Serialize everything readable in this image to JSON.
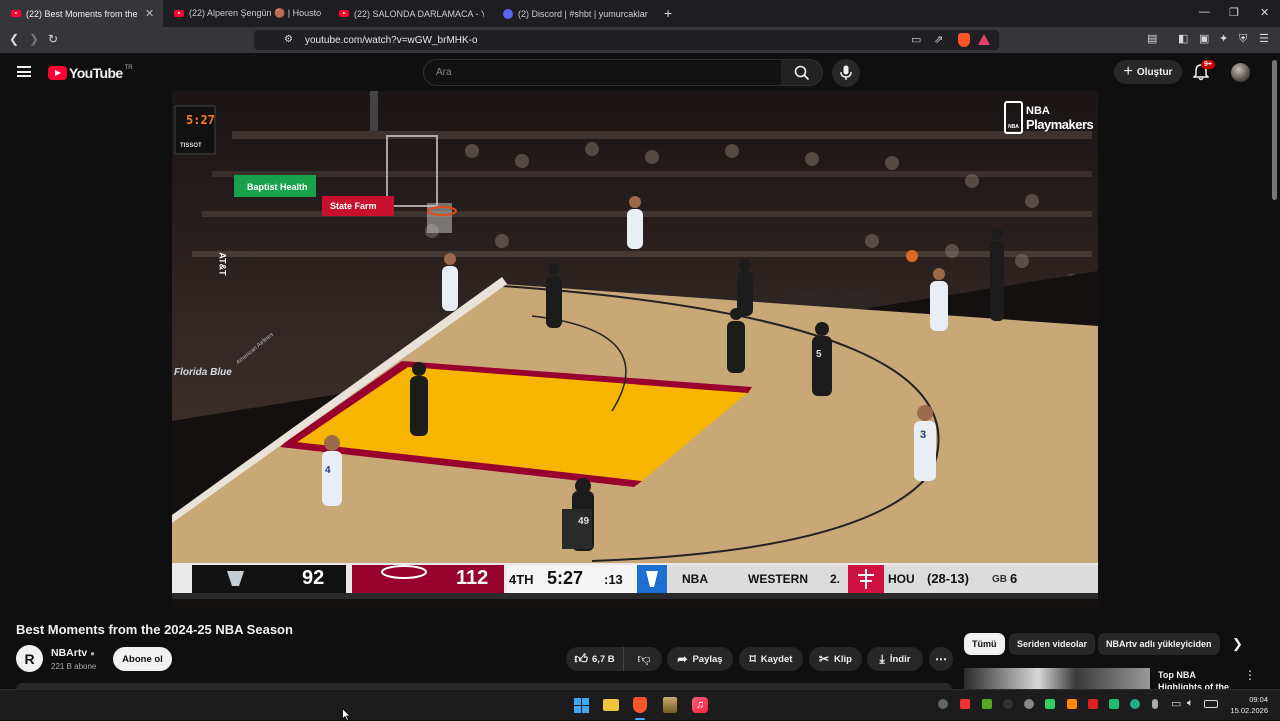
{
  "browser": {
    "tabs": [
      {
        "title": "(22) Best Moments from the 2024-25 NBA Season",
        "favicon": "youtube-icon",
        "active": true
      },
      {
        "title": "(22) Alperen Şengün 🟤 | Houston Rockets",
        "favicon": "youtube-icon",
        "active": false
      },
      {
        "title": "(22) SALONDA DARLAMACA - YouTube",
        "favicon": "youtube-icon",
        "active": false
      },
      {
        "title": "(2) Discord | #shbt | yumurcaklar",
        "favicon": "discord-icon",
        "active": false
      }
    ],
    "tab_close": "✕",
    "new_tab": "+",
    "url": "youtube.com/watch?v=wGW_brMHK-o"
  },
  "youtube": {
    "logo_text": "YouTube",
    "region": "TR",
    "search_placeholder": "Ara",
    "create_label": "Oluştur",
    "notif_badge": "9+"
  },
  "video": {
    "shot_clock": "5:27",
    "shot_clock_brand": "TISSOT",
    "sponsor_baptist": "Baptist Health",
    "sponsor_statefarm": "State Farm",
    "arena_text": "Florida Blue",
    "airline_text": "American Airlines",
    "att_text": "AT&T",
    "court_text": "Baptist Health",
    "watermark_top": "NBA",
    "watermark_bottom": "Playmakers",
    "jersey_numbers": [
      "49",
      "5",
      "3",
      "4"
    ],
    "scoreboard": {
      "away_score": "92",
      "home_score": "112",
      "quarter": "4TH",
      "clock": "5:27",
      "shot": ":13",
      "league": "NBA",
      "conference": "WESTERN",
      "rank": "2.",
      "team": "HOU",
      "record": "(28-13)",
      "gb_label": "GB",
      "gb_value": "6"
    }
  },
  "meta": {
    "title": "Best Moments from the 2024-25 NBA Season",
    "channel": "NBArtv",
    "channel_avatar": "R",
    "subscribers": "221 B abone",
    "subscribe_label": "Abone ol",
    "likes": "6,7 B",
    "share_label": "Paylaş",
    "save_label": "Kaydet",
    "clip_label": "Klip",
    "download_label": "İndir"
  },
  "related": {
    "chips": [
      "Tümü",
      "Seriden videolar",
      "NBArtv adlı yükleyiciden"
    ],
    "first_title_line1": "Top NBA",
    "first_title_line2": "Highlights of the"
  },
  "taskbar": {
    "time": "09:04",
    "date": "15.02.2026"
  },
  "colors": {
    "youtube_red": "#ff0033",
    "spurs_black": "#111111",
    "heat_red": "#98002e",
    "rockets_red": "#ce1141",
    "paint_yellow": "#f7b500"
  }
}
